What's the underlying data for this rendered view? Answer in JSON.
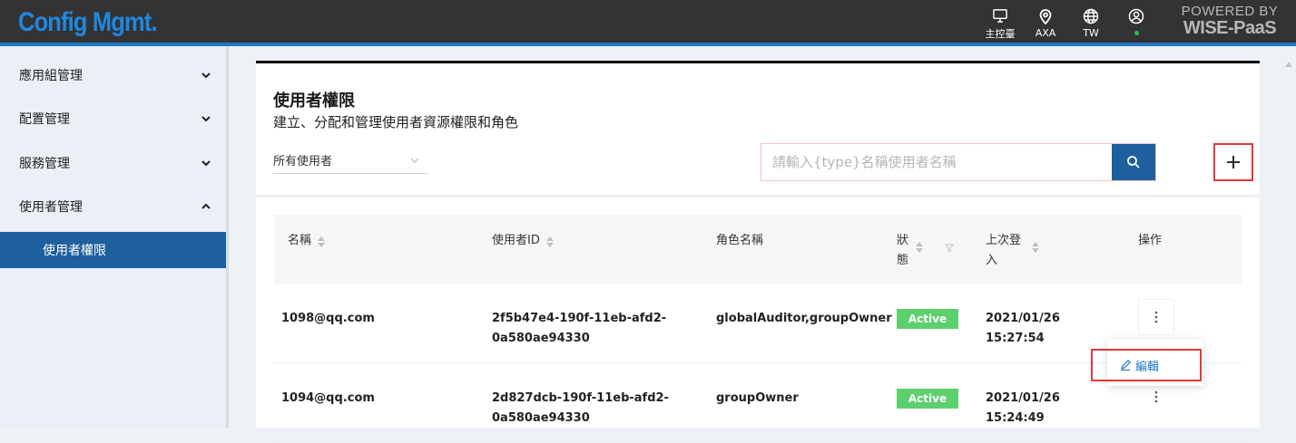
{
  "header": {
    "app_title": "Config Mgmt.",
    "nav": [
      {
        "label": "主控臺",
        "icon": "monitor-icon"
      },
      {
        "label": "AXA",
        "icon": "location-pin-icon"
      },
      {
        "label": "TW",
        "icon": "globe-icon"
      },
      {
        "label": "",
        "icon": "user-icon"
      }
    ],
    "powered_line1": "POWERED BY",
    "powered_line2": "WISE-PaaS",
    "accent_color": "#1f78c4",
    "title_color": "#1f88e0"
  },
  "sidebar": {
    "items": [
      {
        "label": "應用組管理",
        "expanded": false
      },
      {
        "label": "配置管理",
        "expanded": false
      },
      {
        "label": "服務管理",
        "expanded": false
      },
      {
        "label": "使用者管理",
        "expanded": true
      }
    ],
    "sub_items": [
      {
        "label": "使用者權限",
        "active": true
      }
    ],
    "active_color": "#1e5f9e"
  },
  "page": {
    "title": "使用者權限",
    "subtitle": "建立、分配和管理使用者資源權限和角色",
    "filter_value": "所有使用者",
    "search_placeholder": "請輸入{type}名稱使用者名稱"
  },
  "table": {
    "columns": [
      "名稱",
      "使用者ID",
      "角色名稱",
      "狀",
      "態",
      "上次登",
      "入",
      "操作"
    ],
    "rows": [
      {
        "name": "1098@qq.com",
        "user_id_1": "2f5b47e4-190f-11eb-afd2-",
        "user_id_2": "0a580ae94330",
        "role": "globalAuditor,groupOwner",
        "status": "Active",
        "last_login_date": "2021/01/26",
        "last_login_time": "15:27:54"
      },
      {
        "name": "1094@qq.com",
        "user_id_1": "2d827dcb-190f-11eb-afd2-",
        "user_id_2": "0a580ae94330",
        "role": "groupOwner",
        "status": "Active",
        "last_login_date": "2021/01/26",
        "last_login_time": "15:24:49"
      }
    ],
    "status_color": "#5dd06e"
  },
  "action_menu": {
    "edit_label": "編輯",
    "highlight_color": "#e03a3a"
  }
}
